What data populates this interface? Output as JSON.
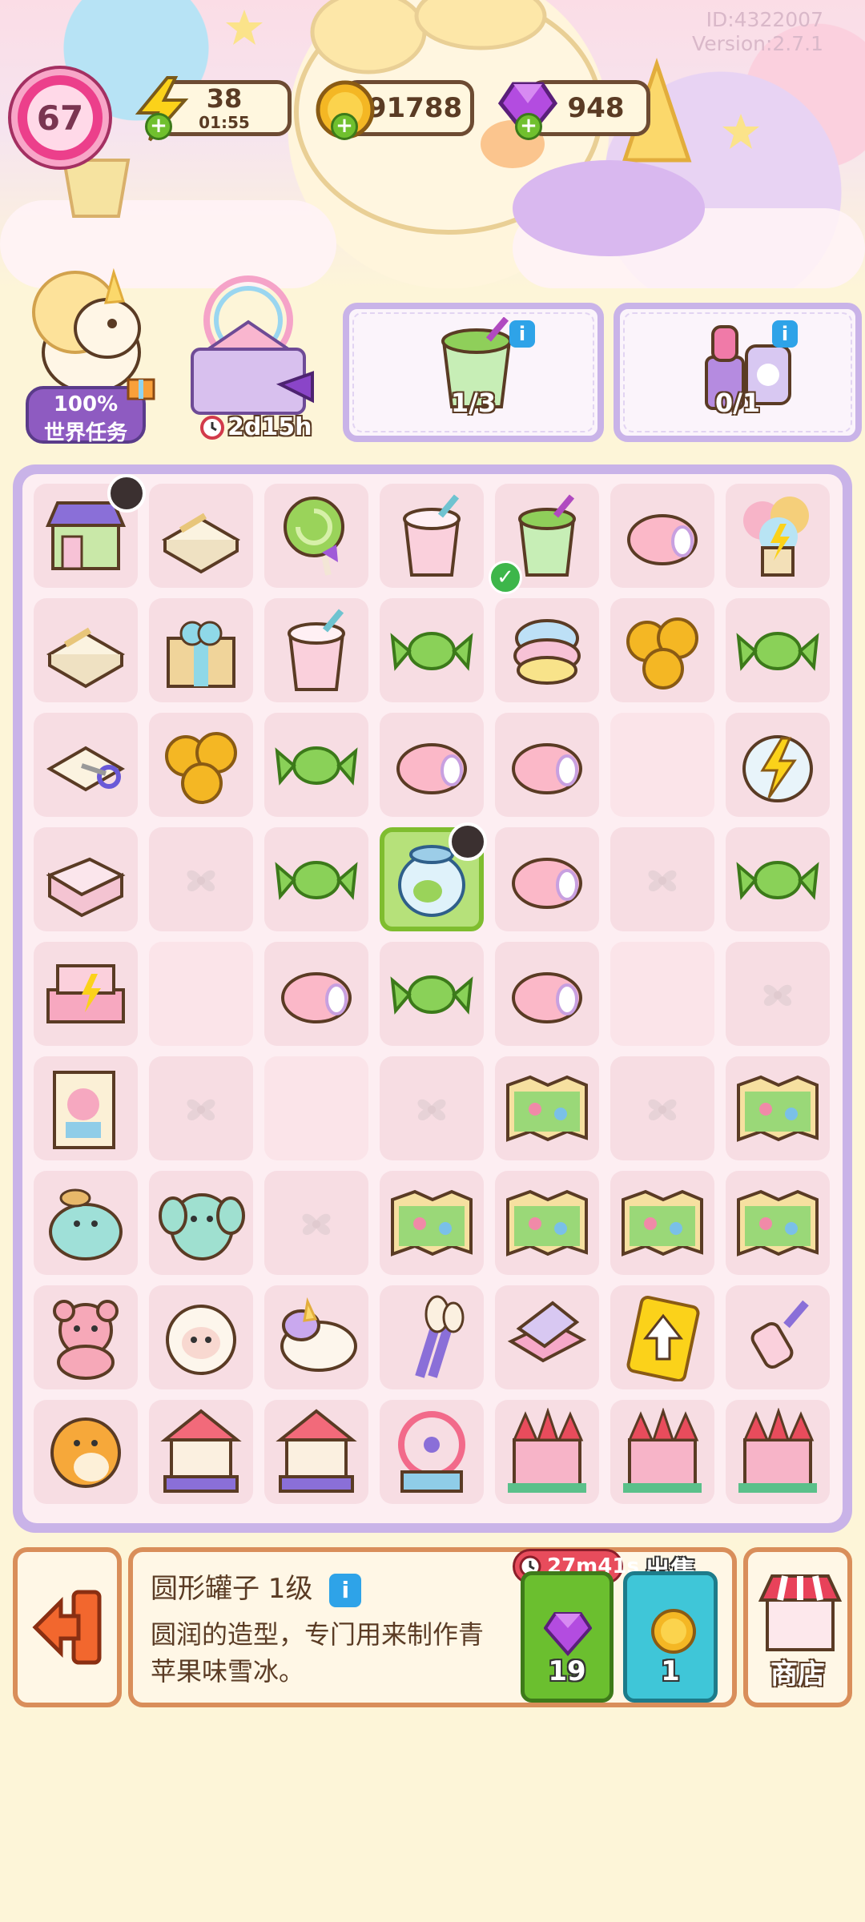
{
  "header": {
    "player_id": "ID:4322007",
    "version": "Version:2.7.1",
    "level": "67",
    "energy": {
      "value": "38",
      "timer": "01:55",
      "icon": "lightning-icon"
    },
    "coins": {
      "value": "91788",
      "icon": "coin-icon"
    },
    "gems": {
      "value": "948",
      "icon": "gem-icon"
    }
  },
  "quests": {
    "world_task": {
      "percent": "100%",
      "label": "世界任务",
      "icon": "unicorn-avatar"
    },
    "event_timer": {
      "time": "2d15h",
      "icon": "carnival-icon"
    },
    "orders": [
      {
        "count": "1/3",
        "icon": "green-apple-drink-icon"
      },
      {
        "count": "0/1",
        "icon": "lipstick-perfume-icon"
      }
    ]
  },
  "board": {
    "rows": [
      [
        "shop-building",
        "paper-pack",
        "green-lollipop",
        "strawberry-drink",
        "green-apple-drink",
        "pink-mochi",
        "balloon-bundle"
      ],
      [
        "paper-pack",
        "gift-box",
        "strawberry-drink",
        "green-candy",
        "rainbow-cotton-candy",
        "coin-stack",
        "green-candy"
      ],
      [
        "paper-scissors",
        "coin-stack",
        "green-candy",
        "pink-mochi",
        "pink-mochi",
        "empty",
        "energy-jar"
      ],
      [
        "pink-drawer",
        "locked",
        "green-candy",
        "round-jar",
        "pink-mochi",
        "locked",
        "green-candy"
      ],
      [
        "pink-bed",
        "empty",
        "pink-mochi",
        "green-candy",
        "pink-mochi",
        "empty",
        "locked"
      ],
      [
        "storybook",
        "locked",
        "empty",
        "locked",
        "park-map",
        "locked",
        "park-map"
      ],
      [
        "teal-seal-plush",
        "elephant-plush",
        "locked",
        "park-map",
        "park-map",
        "park-map",
        "park-map"
      ],
      [
        "bear-plush",
        "sheep-plush",
        "unicorn-plush",
        "makeup-brushes",
        "compact-mirror",
        "upgrade-card",
        "lint-roller"
      ],
      [
        "hamster-plush",
        "carousel",
        "carousel",
        "ferris-wheel",
        "castle",
        "castle",
        "castle"
      ]
    ],
    "selected": "round-jar"
  },
  "selected_item": {
    "name": "圆形罐子 1级",
    "description": "圆润的造型，专门用来制作青苹果味雪冰。",
    "speedup_time": "27m41s",
    "speedup_cost": "19",
    "sell_label": "出售",
    "sell_price": "1"
  },
  "nav": {
    "exit_icon": "exit-arrow-icon",
    "shop_label": "商店"
  },
  "colors": {
    "board_frame": "#c9b3e8",
    "cell": "#f7dde3",
    "selected_cell": "#b6e17a",
    "panel_border": "#d98e5a"
  }
}
